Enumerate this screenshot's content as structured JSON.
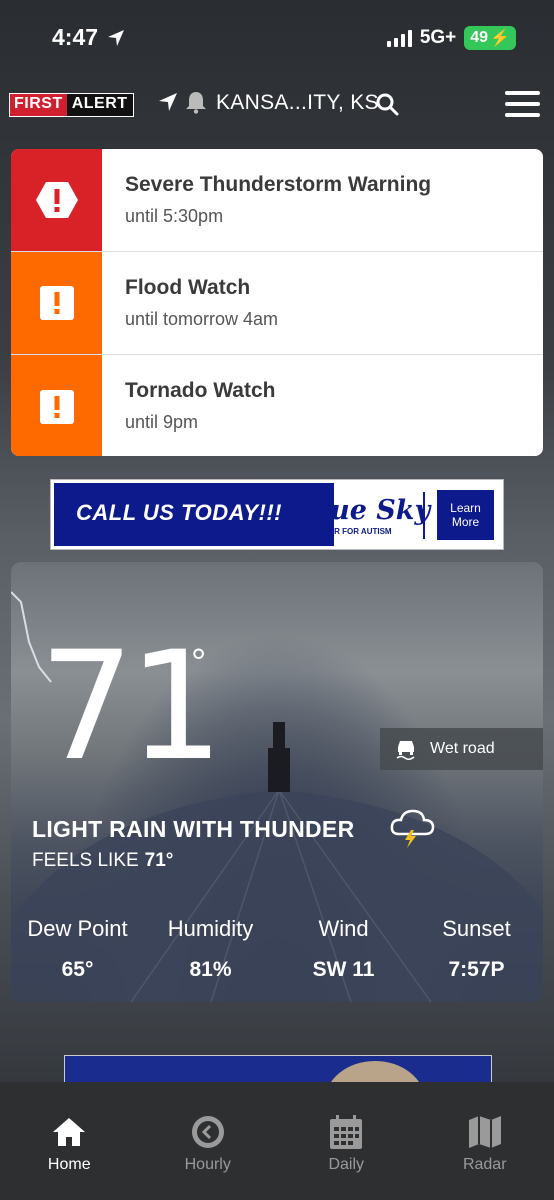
{
  "status_bar": {
    "time": "4:47",
    "network": "5G+",
    "battery": "49"
  },
  "header": {
    "logo_first": "FIRST",
    "logo_alert": "ALERT",
    "city": "KANSA...ITY, KS"
  },
  "alerts": [
    {
      "title": "Severe Thunderstorm Warning",
      "until": "until 5:30pm",
      "color": "#d92128"
    },
    {
      "title": "Flood Watch",
      "until": "until tomorrow 4am",
      "color": "#ff6a00"
    },
    {
      "title": "Tornado Watch",
      "until": "until 9pm",
      "color": "#ff6a00"
    }
  ],
  "ad": {
    "call": "CALL US TODAY!!!",
    "brand": "Blue Sky",
    "brand_sub": "CENTER FOR AUTISM",
    "learn_1": "Learn",
    "learn_2": "More"
  },
  "current": {
    "temperature": "71",
    "degree": "°",
    "road_condition": "Wet road",
    "condition": "LIGHT RAIN WITH THUNDER",
    "feels_like_label": "FEELS LIKE",
    "feels_like_value": "71°",
    "stats": [
      {
        "label": "Dew Point",
        "value": "65°"
      },
      {
        "label": "Humidity",
        "value": "81%"
      },
      {
        "label": "Wind",
        "value": "SW 11"
      },
      {
        "label": "Sunset",
        "value": "7:57P"
      }
    ]
  },
  "tabs": [
    {
      "label": "Home",
      "icon": "home-icon",
      "active": true
    },
    {
      "label": "Hourly",
      "icon": "clock-icon",
      "active": false
    },
    {
      "label": "Daily",
      "icon": "calendar-icon",
      "active": false
    },
    {
      "label": "Radar",
      "icon": "map-icon",
      "active": false
    }
  ]
}
